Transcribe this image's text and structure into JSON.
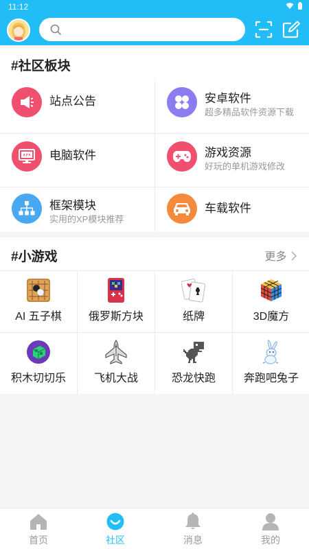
{
  "status_bar": {
    "time": "11:12",
    "icons": [
      "wifi-icon",
      "battery-icon"
    ]
  },
  "header": {
    "search_placeholder": "",
    "icons": [
      "avatar",
      "search-icon",
      "scan-icon",
      "edit-icon"
    ]
  },
  "community": {
    "title": "#社区板块",
    "categories": [
      {
        "name": "站点公告",
        "desc": "",
        "icon": "megaphone-icon",
        "color": "#f0506e"
      },
      {
        "name": "安卓软件",
        "desc": "超多精品软件资源下载",
        "icon": "grid-icon",
        "color": "#8b7cf0"
      },
      {
        "name": "电脑软件",
        "desc": "",
        "icon": "monitor-icon",
        "color": "#f0506e"
      },
      {
        "name": "游戏资源",
        "desc": "好玩的单机游戏修改",
        "icon": "gamepad-icon",
        "color": "#f0506e"
      },
      {
        "name": "框架模块",
        "desc": "实用的XP模块推荐",
        "icon": "sitemap-icon",
        "color": "#4aa8f0"
      },
      {
        "name": "车载软件",
        "desc": "",
        "icon": "car-icon",
        "color": "#f58a3c"
      }
    ]
  },
  "games": {
    "title": "#小游戏",
    "more": "更多",
    "items": [
      {
        "name": "AI 五子棋",
        "icon": "gomoku-icon"
      },
      {
        "name": "俄罗斯方块",
        "icon": "tetris-icon"
      },
      {
        "name": "纸牌",
        "icon": "cards-icon"
      },
      {
        "name": "3D魔方",
        "icon": "rubiks-cube-icon"
      },
      {
        "name": "积木切切乐",
        "icon": "block-cut-icon"
      },
      {
        "name": "飞机大战",
        "icon": "plane-icon"
      },
      {
        "name": "恐龙快跑",
        "icon": "dinosaur-icon"
      },
      {
        "name": "奔跑吧兔子",
        "icon": "rabbit-icon"
      }
    ]
  },
  "tabs": [
    {
      "label": "首页",
      "icon": "home-icon",
      "active": false
    },
    {
      "label": "社区",
      "icon": "community-icon",
      "active": true
    },
    {
      "label": "消息",
      "icon": "bell-icon",
      "active": false
    },
    {
      "label": "我的",
      "icon": "profile-icon",
      "active": false
    }
  ],
  "colors": {
    "accent": "#22bdf6",
    "inactive": "#999999"
  }
}
